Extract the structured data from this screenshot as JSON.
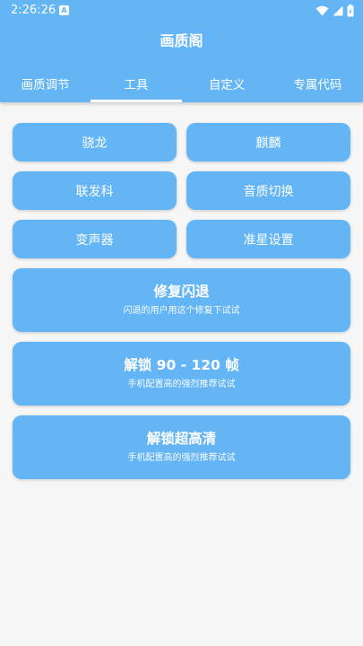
{
  "status_bar": {
    "time": "2:26:26",
    "notification_badge": "A",
    "icons": [
      "wifi-icon",
      "signal-icon",
      "battery-icon"
    ]
  },
  "app": {
    "title": "画质阁"
  },
  "tabs": [
    {
      "label": "画质调节",
      "active": false
    },
    {
      "label": "工具",
      "active": true
    },
    {
      "label": "自定义",
      "active": false
    },
    {
      "label": "专属代码",
      "active": false
    }
  ],
  "buttons": [
    {
      "label": "骁龙"
    },
    {
      "label": "麒麟"
    },
    {
      "label": "联发科"
    },
    {
      "label": "音质切换"
    },
    {
      "label": "变声器"
    },
    {
      "label": "准星设置"
    }
  ],
  "wide_buttons": [
    {
      "title": "修复闪退",
      "subtitle": "闪退的用户用这个修复下试试"
    },
    {
      "title": "解锁 90 - 120 帧",
      "subtitle": "手机配置高的强烈推荐试试"
    },
    {
      "title": "解锁超高清",
      "subtitle": "手机配置高的强烈推荐试试"
    }
  ],
  "colors": {
    "primary": "#64b5f6",
    "background": "#f6f6f6",
    "text_on_primary": "#ffffff"
  }
}
